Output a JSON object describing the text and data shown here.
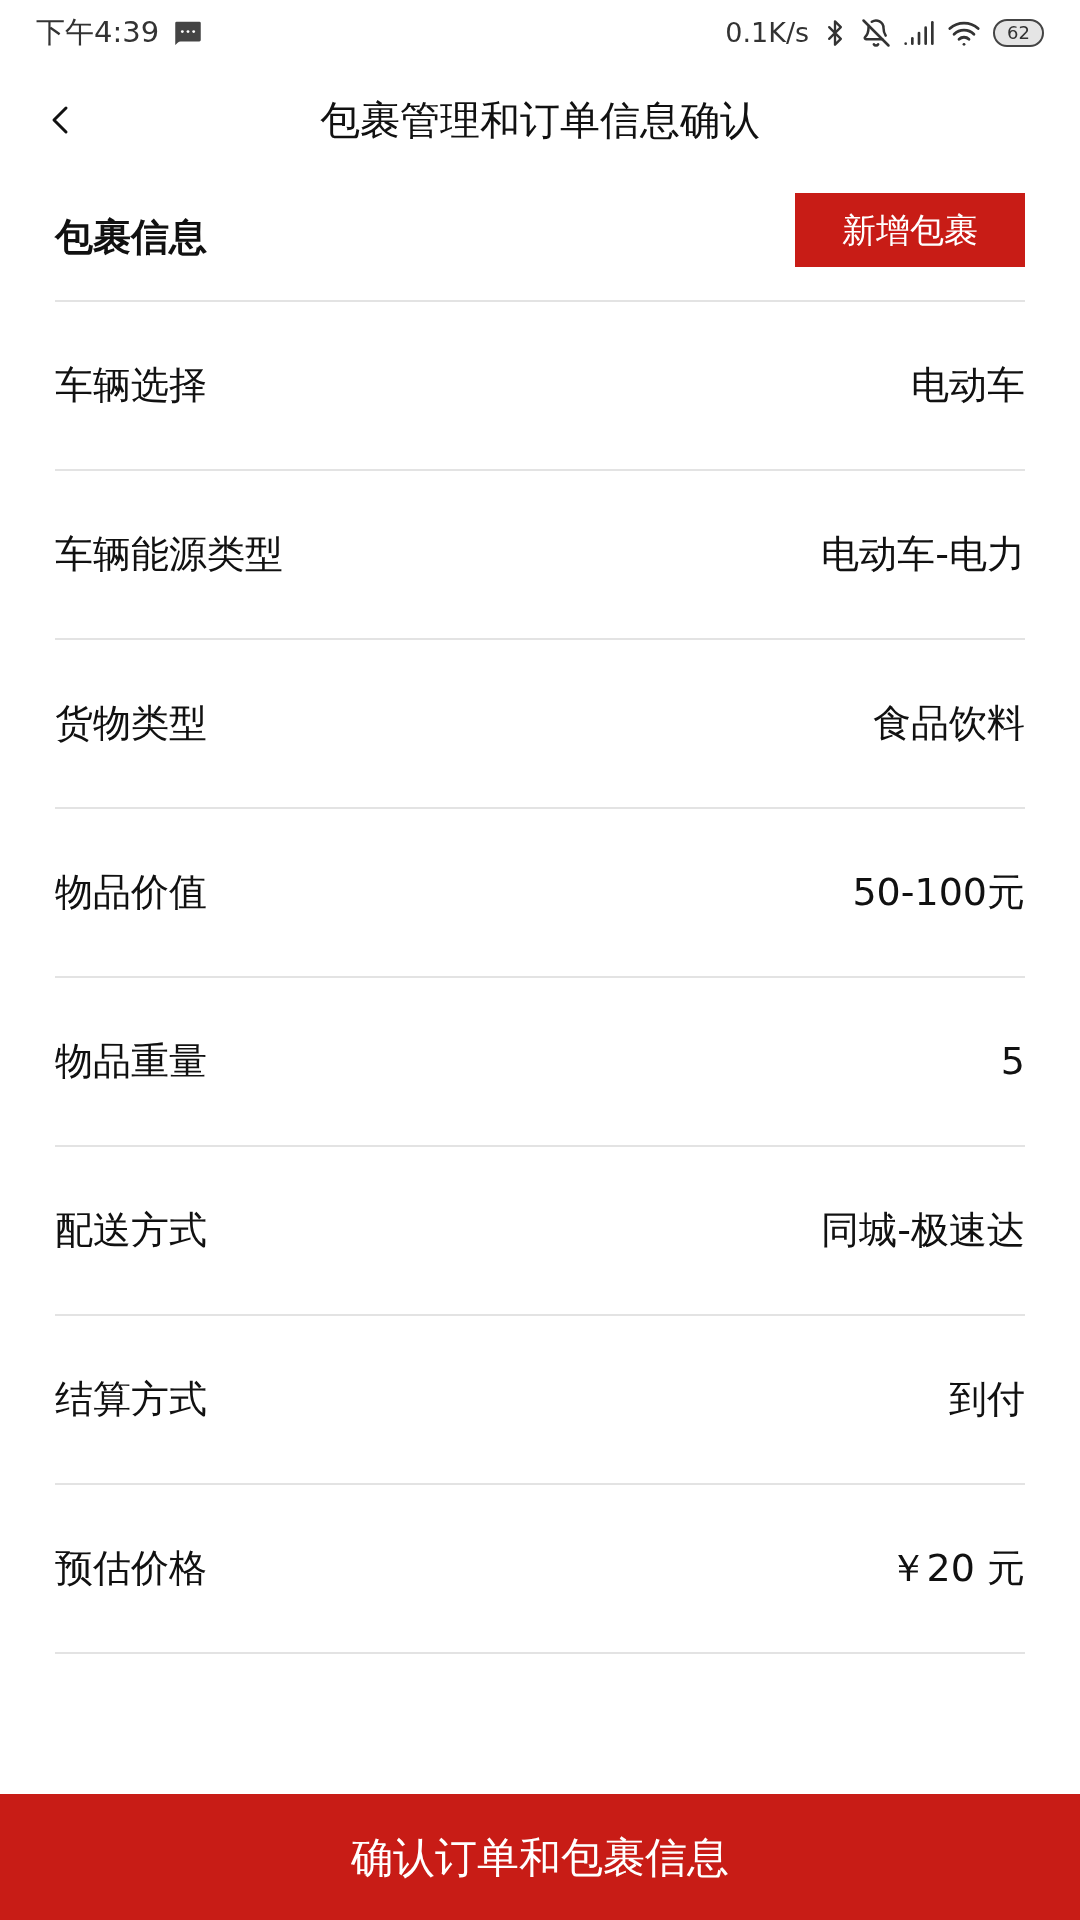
{
  "status_bar": {
    "time": "下午4:39",
    "network_speed": "0.1K/s",
    "battery": "62"
  },
  "header": {
    "title": "包裹管理和订单信息确认"
  },
  "section": {
    "title": "包裹信息",
    "add_button": "新增包裹"
  },
  "rows": [
    {
      "label": "车辆选择",
      "value": "电动车"
    },
    {
      "label": "车辆能源类型",
      "value": "电动车-电力"
    },
    {
      "label": "货物类型",
      "value": "食品饮料"
    },
    {
      "label": "物品价值",
      "value": "50-100元"
    },
    {
      "label": "物品重量",
      "value": "5"
    },
    {
      "label": "配送方式",
      "value": "同城-极速达"
    },
    {
      "label": "结算方式",
      "value": "到付"
    },
    {
      "label": "预估价格",
      "value": "￥20 元"
    }
  ],
  "confirm_button": "确认订单和包裹信息"
}
